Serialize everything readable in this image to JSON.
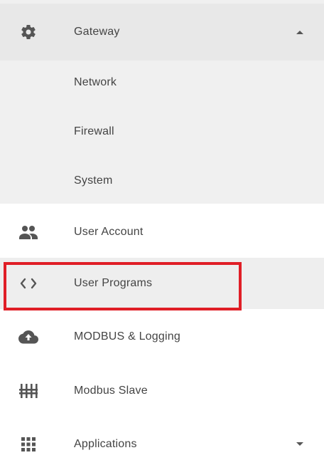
{
  "menu": {
    "gateway": {
      "label": "Gateway",
      "icon": "gear-icon",
      "expanded": true,
      "children": [
        {
          "label": "Network"
        },
        {
          "label": "Firewall"
        },
        {
          "label": "System"
        }
      ]
    },
    "items": [
      {
        "label": "User Account",
        "icon": "users-icon"
      },
      {
        "label": "User Programs",
        "icon": "code-icon",
        "selected": true
      },
      {
        "label": "MODBUS & Logging",
        "icon": "cloud-upload-icon"
      },
      {
        "label": "Modbus Slave",
        "icon": "sliders-icon"
      },
      {
        "label": "Applications",
        "icon": "apps-grid-icon",
        "expandable": true
      }
    ]
  },
  "colors": {
    "highlight_border": "#e01e26",
    "submenu_bg": "#f0f0f0",
    "selected_bg": "#eeeeee",
    "icon": "#555555"
  }
}
